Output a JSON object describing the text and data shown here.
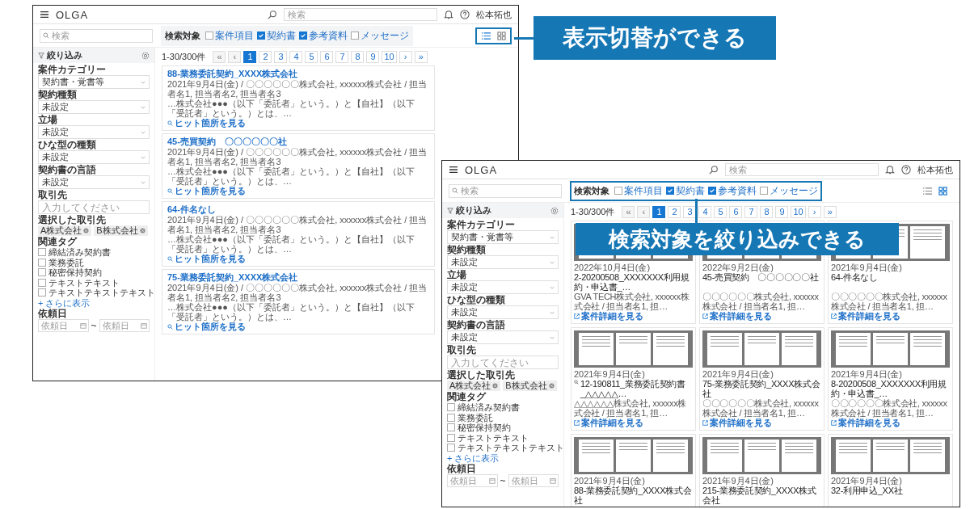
{
  "windows": [
    {
      "kind": "list",
      "header": {
        "logo": "OLGA",
        "search_placeholder": "検索",
        "user": "松本拓也"
      },
      "search_placeholder": "検索",
      "target_filter": {
        "highlighted": false,
        "label": "検索対象",
        "options": [
          {
            "label": "案件項目",
            "checked": false
          },
          {
            "label": "契約書",
            "checked": true
          },
          {
            "label": "参考資料",
            "checked": true
          },
          {
            "label": "メッセージ",
            "checked": false
          }
        ]
      },
      "view_toggle": {
        "highlighted": true,
        "options": [
          {
            "kind": "list",
            "selected": true
          },
          {
            "kind": "grid",
            "selected": false
          }
        ]
      },
      "sidebar": {
        "title": "絞り込み",
        "fields": [
          {
            "kind": "select",
            "label": "案件カテゴリー",
            "value": "契約書・覚書等"
          },
          {
            "kind": "select",
            "label": "契約種類",
            "value": "未設定"
          },
          {
            "kind": "select",
            "label": "立場",
            "value": "未設定"
          },
          {
            "kind": "select",
            "label": "ひな型の種類",
            "value": "未設定"
          },
          {
            "kind": "select",
            "label": "契約書の言語",
            "value": "未設定"
          },
          {
            "kind": "input",
            "label": "取引先",
            "placeholder": "入力してください"
          },
          {
            "kind": "chips",
            "label": "選択した取引先",
            "chips": [
              "A株式会社",
              "B株式会社"
            ]
          },
          {
            "kind": "checkboxes",
            "label": "関連タグ",
            "options": [
              {
                "label": "締結済み契約書",
                "checked": false
              },
              {
                "label": "業務委託",
                "checked": false
              },
              {
                "label": "秘密保持契約",
                "checked": false
              },
              {
                "label": "テキストテキスト",
                "checked": false
              },
              {
                "label": "テキストテキストテキスト",
                "checked": false
              }
            ],
            "more": "+ さらに表示"
          },
          {
            "kind": "date_range",
            "label": "依頼日",
            "from_placeholder": "依頼日",
            "separator": "~",
            "to_placeholder": "依頼日"
          }
        ]
      },
      "pagination": {
        "count": "1-30/300件",
        "pages": [
          {
            "label": "«",
            "selected": false,
            "disabled": true
          },
          {
            "label": "‹",
            "selected": false,
            "disabled": true
          },
          {
            "label": "1",
            "selected": true,
            "disabled": false
          },
          {
            "label": "2",
            "selected": false,
            "disabled": false
          },
          {
            "label": "3",
            "selected": false,
            "disabled": false
          },
          {
            "label": "4",
            "selected": false,
            "disabled": false
          },
          {
            "label": "5",
            "selected": false,
            "disabled": false
          },
          {
            "label": "6",
            "selected": false,
            "disabled": false
          },
          {
            "label": "7",
            "selected": false,
            "disabled": false
          },
          {
            "label": "8",
            "selected": false,
            "disabled": false
          },
          {
            "label": "9",
            "selected": false,
            "disabled": false
          },
          {
            "label": "10",
            "selected": false,
            "disabled": false
          },
          {
            "label": "›",
            "selected": false,
            "disabled": false
          },
          {
            "label": "»",
            "selected": false,
            "disabled": false
          }
        ]
      },
      "results": [
        {
          "title": "88-業務委託契約_XXXX株式会社",
          "meta": "2021年9月4日(金) / 〇〇〇〇〇〇株式会社, xxxxxx株式会社 / 担当者名1, 担当者名2, 担当者名3",
          "snippet": "…株式会社●●●（以下「委託者」という。）と【自社】（以下「受託者」という。）とは、…",
          "link": "ヒット箇所を見る"
        },
        {
          "title": "45-売買契約　〇〇〇〇〇〇社",
          "meta": "2021年9月4日(金) / 〇〇〇〇〇〇株式会社, xxxxxx株式会社 / 担当者名1, 担当者名2, 担当者名3",
          "snippet": "…株式会社●●●（以下「委託者」という。）と【自社】（以下「受託者」という。）とは、…",
          "link": "ヒット箇所を見る"
        },
        {
          "title": "64-件名なし",
          "meta": "2021年9月4日(金) / 〇〇〇〇〇〇株式会社, xxxxxx株式会社 / 担当者名1, 担当者名2, 担当者名3",
          "snippet": "…株式会社●●●（以下「委託者」という。）と【自社】（以下「受託者」という。）とは、…",
          "link": "ヒット箇所を見る"
        },
        {
          "title": "75-業務委託契約_XXXX株式会社",
          "meta": "2021年9月4日(金) / 〇〇〇〇〇〇株式会社, xxxxxx株式会社 / 担当者名1, 担当者名2, 担当者名3",
          "snippet": "…株式会社●●●（以下「委託者」という。）と【自社】（以下「受託者」という。）とは、…",
          "link": "ヒット箇所を見る"
        }
      ]
    },
    {
      "kind": "grid",
      "header": {
        "logo": "OLGA",
        "search_placeholder": "検索",
        "user": "松本拓也"
      },
      "search_placeholder": "検索",
      "target_filter": {
        "highlighted": true,
        "label": "検索対象",
        "options": [
          {
            "label": "案件項目",
            "checked": false
          },
          {
            "label": "契約書",
            "checked": true
          },
          {
            "label": "参考資料",
            "checked": true
          },
          {
            "label": "メッセージ",
            "checked": false
          }
        ]
      },
      "view_toggle": {
        "highlighted": false,
        "options": [
          {
            "kind": "list",
            "selected": false
          },
          {
            "kind": "grid",
            "selected": true
          }
        ]
      },
      "sidebar": {
        "title": "絞り込み",
        "fields": [
          {
            "kind": "select",
            "label": "案件カテゴリー",
            "value": "契約書・覚書等"
          },
          {
            "kind": "select",
            "label": "契約種類",
            "value": "未設定"
          },
          {
            "kind": "select",
            "label": "立場",
            "value": "未設定"
          },
          {
            "kind": "select",
            "label": "ひな型の種類",
            "value": "未設定"
          },
          {
            "kind": "select",
            "label": "契約書の言語",
            "value": "未設定"
          },
          {
            "kind": "input",
            "label": "取引先",
            "placeholder": "入力してください"
          },
          {
            "kind": "chips",
            "label": "選択した取引先",
            "chips": [
              "A株式会社",
              "B株式会社"
            ]
          },
          {
            "kind": "checkboxes",
            "label": "関連タグ",
            "options": [
              {
                "label": "締結済み契約書",
                "checked": false
              },
              {
                "label": "業務委託",
                "checked": false
              },
              {
                "label": "秘密保持契約",
                "checked": false
              },
              {
                "label": "テキストテキスト",
                "checked": false
              },
              {
                "label": "テキストテキストテキスト",
                "checked": false
              }
            ],
            "more": "+ さらに表示"
          },
          {
            "kind": "date_range",
            "label": "依頼日",
            "from_placeholder": "依頼日",
            "separator": "~",
            "to_placeholder": "依頼日"
          }
        ]
      },
      "pagination": {
        "count": "1-30/300件",
        "pages": [
          {
            "label": "«",
            "selected": false,
            "disabled": true
          },
          {
            "label": "‹",
            "selected": false,
            "disabled": true
          },
          {
            "label": "1",
            "selected": true,
            "disabled": false
          },
          {
            "label": "2",
            "selected": false,
            "disabled": false
          },
          {
            "label": "3",
            "selected": false,
            "disabled": false
          },
          {
            "label": "4",
            "selected": false,
            "disabled": false
          },
          {
            "label": "5",
            "selected": false,
            "disabled": false
          },
          {
            "label": "6",
            "selected": false,
            "disabled": false
          },
          {
            "label": "7",
            "selected": false,
            "disabled": false
          },
          {
            "label": "8",
            "selected": false,
            "disabled": false
          },
          {
            "label": "9",
            "selected": false,
            "disabled": false
          },
          {
            "label": "10",
            "selected": false,
            "disabled": false
          },
          {
            "label": "›",
            "selected": false,
            "disabled": false
          },
          {
            "label": "»",
            "selected": false,
            "disabled": false
          }
        ]
      },
      "results": [
        {
          "date": "2022年10月4日(金)",
          "title": "2-20200508_XXXXXXX利用規約・申込書_…",
          "meta": "GVA TECH株式会社, xxxxxx株式会社 / 担当者名1, 担…",
          "link": "案件詳細を見る",
          "search_hit": false
        },
        {
          "date": "2022年9月2日(金)",
          "title": "45-売買契約　〇〇〇〇〇〇社",
          "meta": "〇〇〇〇〇〇株式会社, xxxxxx株式会社 / 担当者名1, 担…",
          "link": "案件詳細を見る",
          "search_hit": false
        },
        {
          "date": "2021年9月4日(金)",
          "title": "64-件名なし",
          "meta": "〇〇〇〇〇〇株式会社, xxxxxx株式会社 / 担当者名1, 担…",
          "link": "案件詳細を見る",
          "search_hit": false
        },
        {
          "date": "2021年9月4日(金)",
          "title": "12-190811_業務委託契約書_△△△△△…",
          "meta": "△△△△△△株式会社, xxxxxx株式会社 / 担当者名1, 担…",
          "link": "案件詳細を見る",
          "search_hit": true
        },
        {
          "date": "2021年9月4日(金)",
          "title": "75-業務委託契約_XXXX株式会社",
          "meta": "〇〇〇〇〇〇株式会社, xxxxxx株式会社 / 担当者名1, 担…",
          "link": "案件詳細を見る",
          "search_hit": false
        },
        {
          "date": "2021年9月4日(金)",
          "title": "8-20200508_XXXXXXX利用規約・申込書_…",
          "meta": "〇〇〇〇〇〇株式会社, xxxxxx株式会社 / 担当者名1, 担…",
          "link": "案件詳細を見る",
          "search_hit": false
        },
        {
          "date": "2021年9月4日(金)",
          "title": "88-業務委託契約_XXXX株式会社",
          "search_hit": false
        },
        {
          "date": "2021年9月4日(金)",
          "title": "215-業務委託契約_XXXX株式会社",
          "search_hit": false
        },
        {
          "date": "2021年9月4日(金)",
          "title": "32-利用申込_XX社",
          "search_hit": false
        }
      ]
    }
  ],
  "callouts": [
    {
      "text": "表示切替ができる"
    },
    {
      "text": "検索対象を絞り込みできる"
    }
  ]
}
